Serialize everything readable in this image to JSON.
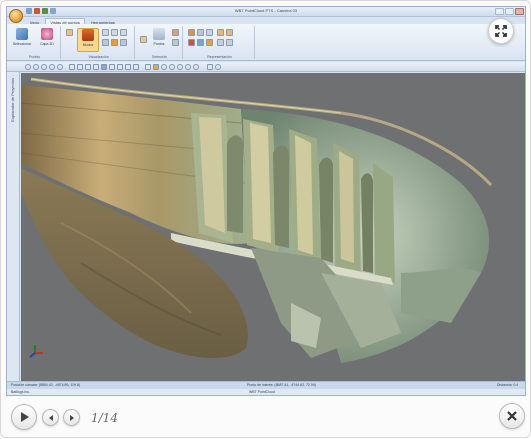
{
  "app": {
    "title": "WBT PointCloud PTS - Cansirol 03",
    "tabs": [
      {
        "label": "Inicio"
      },
      {
        "label": "Vistas de puntos"
      },
      {
        "label": "Herramientas"
      }
    ],
    "ribbon": {
      "groups": [
        {
          "label": "Puntos",
          "buttons": [
            {
              "label": "Seleccionar"
            },
            {
              "label": "Capa 3D"
            }
          ]
        },
        {
          "label": "Visualización",
          "buttons": [
            {
              "label": "Modos"
            }
          ]
        },
        {
          "label": "Selección",
          "buttons": [
            {
              "label": "Puntos"
            }
          ]
        },
        {
          "label": "Representación",
          "buttons": []
        }
      ]
    },
    "side_panel": {
      "label": "Explorador de Proyectos"
    },
    "status_bar": {
      "left": "Posición cámara: (8884.42, -4974.86, 119.8)",
      "center": "Punto de interés: (8687.41, -4744.62, 72.09)",
      "right": "Distancia: 0.4"
    },
    "bottom_strip": {
      "left": "Batllogs Inc.",
      "center": "WBT PointCloud"
    }
  },
  "viewer": {
    "counter": "1/14"
  },
  "colors": {
    "viewport_bg": "#6f7072",
    "ribbon_bg": "#d9e4f1",
    "accent": "#e39a2a"
  }
}
